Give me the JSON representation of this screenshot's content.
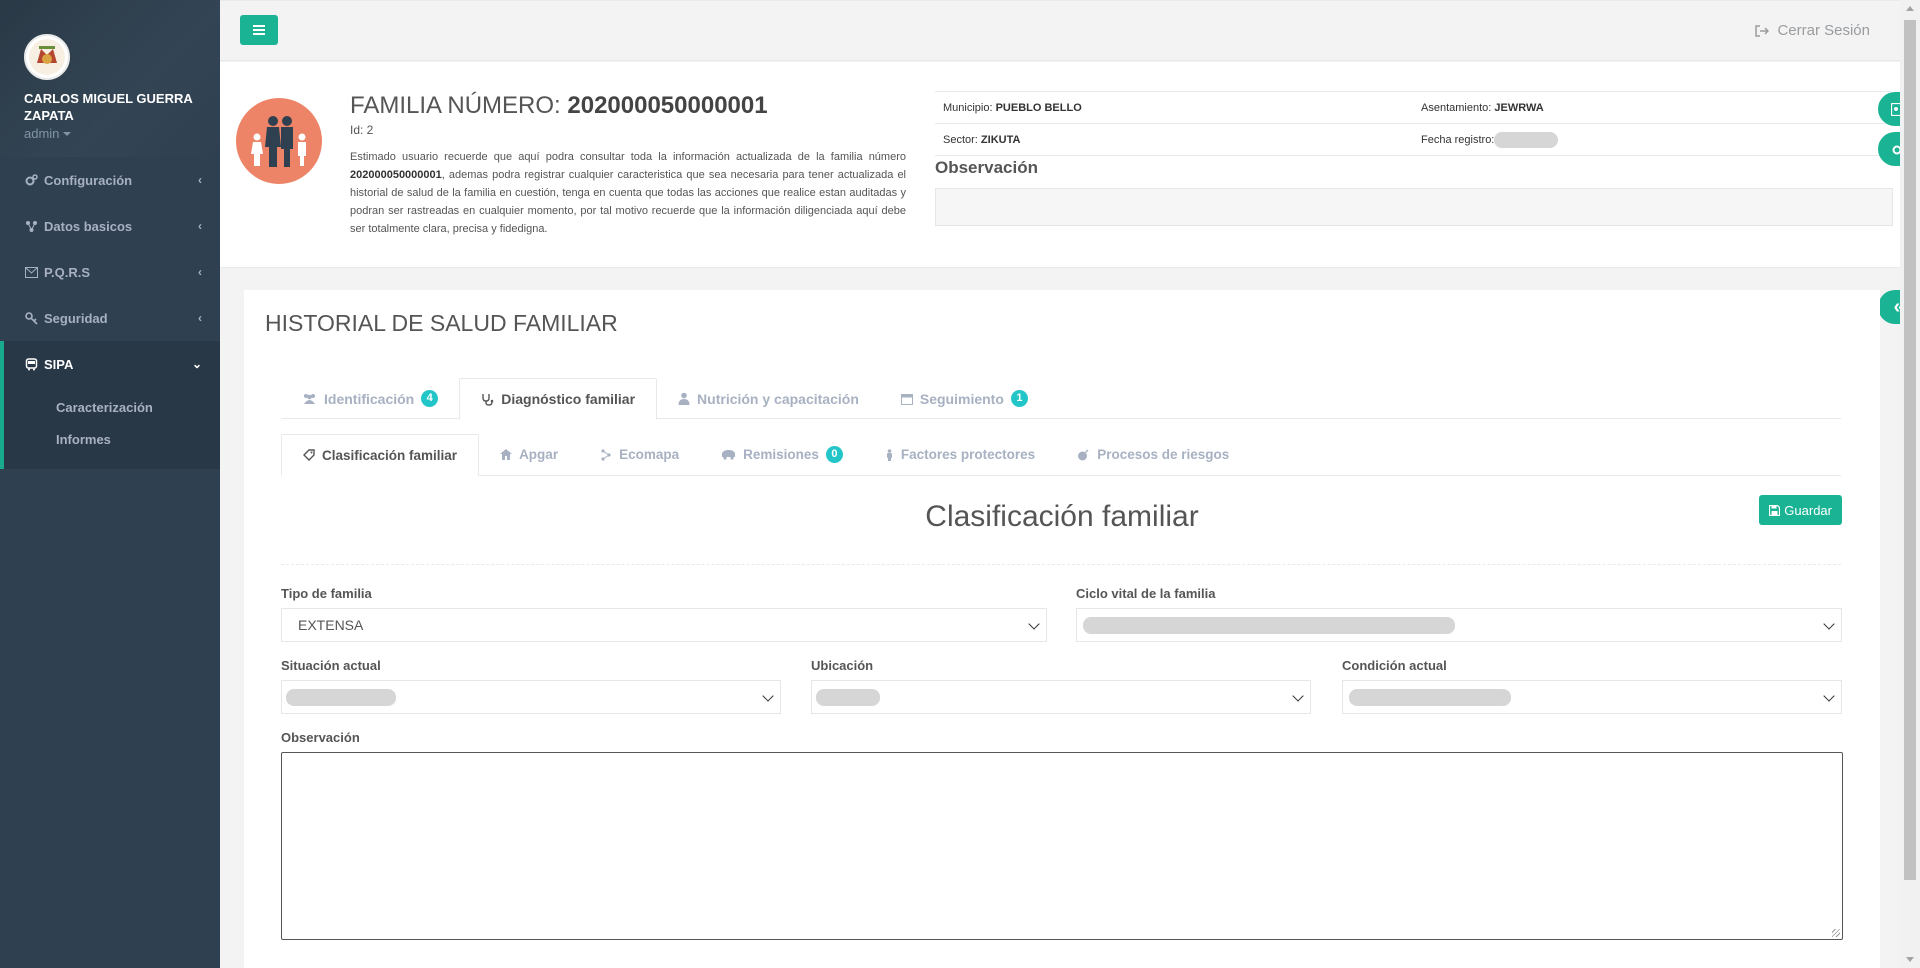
{
  "user": {
    "name": "CARLOS MIGUEL GUERRA ZAPATA",
    "role": "admin"
  },
  "sidebar": {
    "items": [
      {
        "label": "Configuración",
        "icon": "cogs-icon"
      },
      {
        "label": "Datos basicos",
        "icon": "sitemap-icon"
      },
      {
        "label": "P.Q.R.S",
        "icon": "envelope-icon"
      },
      {
        "label": "Seguridad",
        "icon": "key-icon"
      },
      {
        "label": "SIPA",
        "icon": "bus-icon"
      }
    ],
    "sipa_sub": [
      "Caracterización",
      "Informes"
    ]
  },
  "topbar": {
    "logout_label": "Cerrar Sesión"
  },
  "family": {
    "title_prefix": "FAMILIA NÚMERO:",
    "number": "202000050000001",
    "id_label": "Id: 2",
    "desc_1": "Estimado usuario recuerde que aquí podra consultar toda la información actualizada de la familia número ",
    "desc_number": "202000050000001",
    "desc_2": ", ademas podra registrar cualquier caracteristica que sea necesaria para tener actualizada el historial de salud de la familia en cuestión, tenga en cuenta que todas las acciones que realice estan auditadas y podran ser rastreadas en cualquier momento, por tal motivo recuerde que la información diligenciada aquí debe ser totalmente clara, precisa y fidedigna.",
    "municipio_label": "Municipio:",
    "municipio": "PUEBLO BELLO",
    "asentamiento_label": "Asentamiento:",
    "asentamiento": "JEWRWA",
    "sector_label": "Sector:",
    "sector": "ZIKUTA",
    "fecha_label": "Fecha registro:",
    "observacion_label": "Observación"
  },
  "main": {
    "section_title": "HISTORIAL DE SALUD FAMILIAR",
    "tabs": [
      {
        "label": "Identificación",
        "badge": "4"
      },
      {
        "label": "Diagnóstico familiar",
        "badge": ""
      },
      {
        "label": "Nutrición y capacitación",
        "badge": ""
      },
      {
        "label": "Seguimiento",
        "badge": "1"
      }
    ],
    "subtabs": [
      {
        "label": "Clasificación familiar",
        "badge": ""
      },
      {
        "label": "Apgar",
        "badge": ""
      },
      {
        "label": "Ecomapa",
        "badge": ""
      },
      {
        "label": "Remisiones",
        "badge": "0"
      },
      {
        "label": "Factores protectores",
        "badge": ""
      },
      {
        "label": "Procesos de riesgos",
        "badge": ""
      }
    ],
    "form_title": "Clasificación familiar",
    "save_label": "Guardar",
    "fields": {
      "tipo_label": "Tipo de familia",
      "tipo_value": "EXTENSA",
      "ciclo_label": "Ciclo vital de la familia",
      "situacion_label": "Situación actual",
      "ubicacion_label": "Ubicación",
      "condicion_label": "Condición actual",
      "observacion_label": "Observación"
    }
  },
  "colors": {
    "accent": "#1ab394",
    "sidebar": "#2f4050",
    "badge": "#23c6c8",
    "family_icon": "#ee8467"
  }
}
